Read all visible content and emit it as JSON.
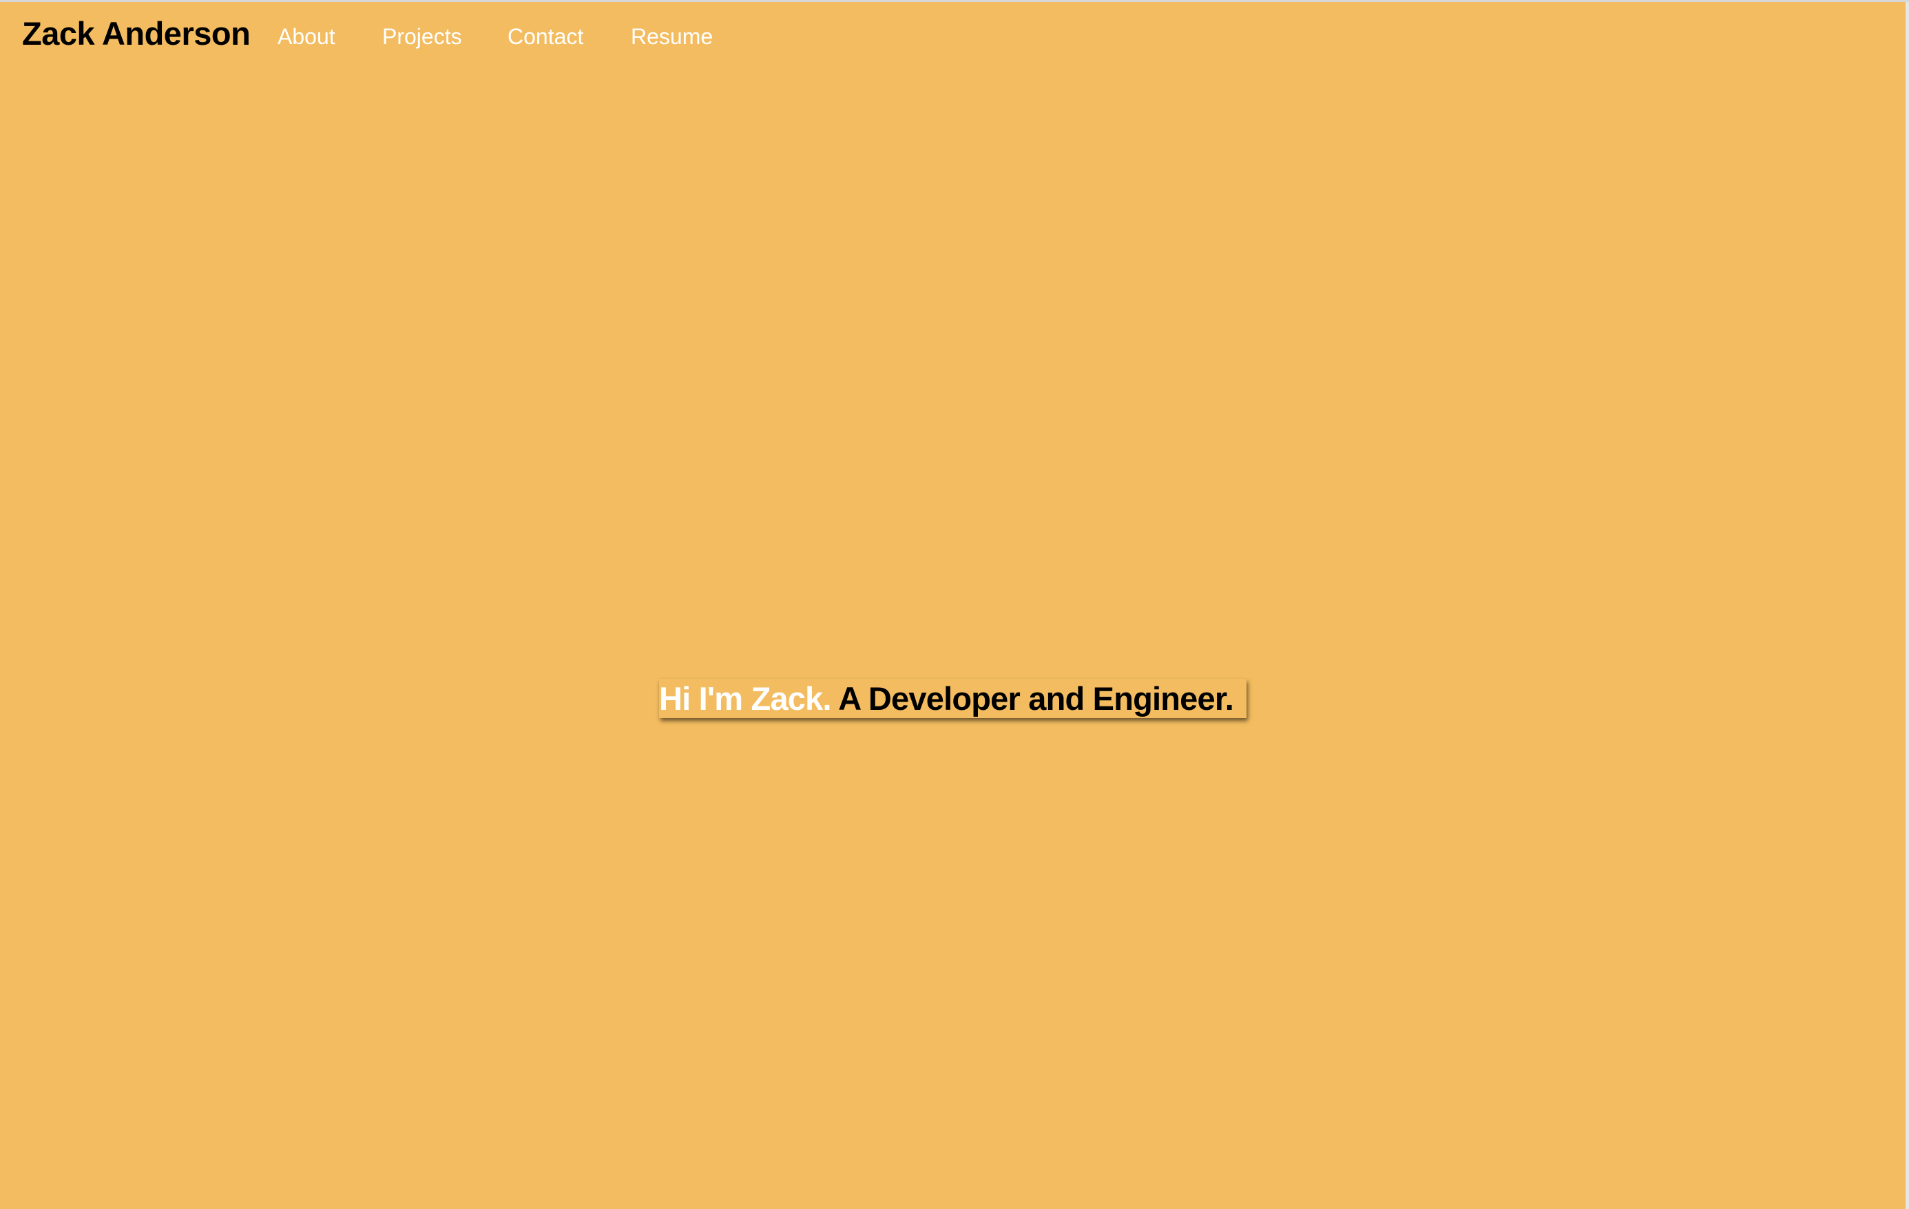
{
  "header": {
    "brand": "Zack Anderson",
    "nav": [
      {
        "label": "About"
      },
      {
        "label": "Projects"
      },
      {
        "label": "Contact"
      },
      {
        "label": "Resume"
      }
    ]
  },
  "hero": {
    "greeting": "Hi I'm Zack.",
    "role": "A Developer and Engineer."
  },
  "colors": {
    "background": "#f3bc60",
    "greeting": "#ffffff",
    "role": "#000000"
  }
}
